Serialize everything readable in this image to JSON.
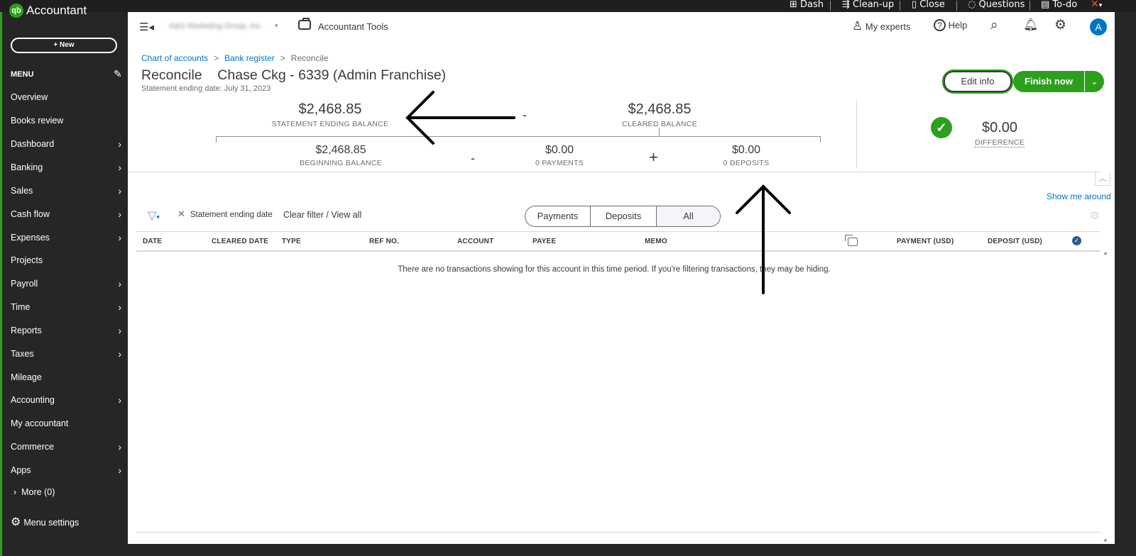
{
  "topbar": {
    "items": [
      "Dash",
      "Clean-up",
      "Close",
      "Questions",
      "To-do"
    ]
  },
  "sidebar": {
    "app_name": "Accountant",
    "logo_text": "qb",
    "new_label": "+   New",
    "menu_label": "MENU",
    "items": [
      {
        "label": "Overview",
        "chevron": false
      },
      {
        "label": "Books review",
        "chevron": false
      },
      {
        "label": "Dashboard",
        "chevron": true
      },
      {
        "label": "Banking",
        "chevron": true
      },
      {
        "label": "Sales",
        "chevron": true
      },
      {
        "label": "Cash flow",
        "chevron": true
      },
      {
        "label": "Expenses",
        "chevron": true
      },
      {
        "label": "Projects",
        "chevron": false
      },
      {
        "label": "Payroll",
        "chevron": true
      },
      {
        "label": "Time",
        "chevron": true
      },
      {
        "label": "Reports",
        "chevron": true
      },
      {
        "label": "Taxes",
        "chevron": true
      },
      {
        "label": "Mileage",
        "chevron": false
      },
      {
        "label": "Accounting",
        "chevron": true
      },
      {
        "label": "My accountant",
        "chevron": false
      },
      {
        "label": "Commerce",
        "chevron": true
      },
      {
        "label": "Apps",
        "chevron": true
      }
    ],
    "more_label": "More (0)",
    "menu_settings_label": "Menu settings"
  },
  "header": {
    "company_name": "A&G Marketing Group, Inc.",
    "accountant_tools": "Accountant Tools",
    "my_experts": "My experts",
    "help": "Help",
    "avatar_letter": "A"
  },
  "breadcrumb": {
    "items": [
      "Chart of accounts",
      "Bank register",
      "Reconcile"
    ]
  },
  "page": {
    "title": "Reconcile    Chase Ckg - 6339 (Admin Franchise)",
    "statement_date": "Statement ending date: July 31, 2023",
    "edit_info": "Edit info",
    "finish_now": "Finish now"
  },
  "summary": {
    "statement_ending_balance": {
      "value": "$2,468.85",
      "label": "STATEMENT ENDING BALANCE"
    },
    "cleared_balance": {
      "value": "$2,468.85",
      "label": "CLEARED BALANCE"
    },
    "beginning_balance": {
      "value": "$2,468.85",
      "label": "BEGINNING BALANCE"
    },
    "payments": {
      "value": "$0.00",
      "label": "0 PAYMENTS"
    },
    "deposits": {
      "value": "$0.00",
      "label": "0 DEPOSITS"
    },
    "difference": {
      "value": "$0.00",
      "label": "DIFFERENCE"
    },
    "minus": "-",
    "plus": "+"
  },
  "filter": {
    "chip": "Statement ending date",
    "clear": "Clear filter / View all",
    "show_me_around": "Show me around",
    "tabs": [
      "Payments",
      "Deposits",
      "All"
    ],
    "selected_tab": "All"
  },
  "table": {
    "columns": [
      "DATE",
      "CLEARED DATE",
      "TYPE",
      "REF NO.",
      "ACCOUNT",
      "PAYEE",
      "MEMO",
      "PAYMENT (USD)",
      "DEPOSIT (USD)"
    ],
    "empty_message": "There are no transactions showing for this account in this time period. If you're filtering transactions, they may be hiding."
  },
  "colors": {
    "brand_green": "#2ca01c",
    "link_blue": "#0077c5",
    "sidebar_bg": "#262626"
  }
}
